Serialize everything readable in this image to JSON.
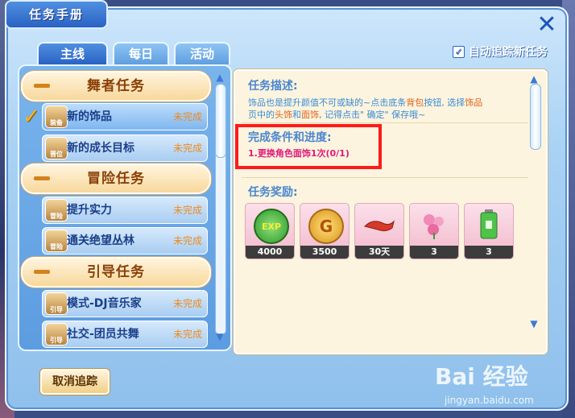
{
  "window": {
    "title": "任务手册",
    "close_symbol": "✕"
  },
  "tabs": [
    {
      "label": "主线",
      "active": true
    },
    {
      "label": "每日",
      "active": false
    },
    {
      "label": "活动",
      "active": false
    }
  ],
  "auto_track": {
    "label": "自动追踪新任务",
    "checked": true
  },
  "categories": [
    {
      "title": "舞者任务"
    },
    {
      "title": "冒险任务"
    },
    {
      "title": "引导任务"
    }
  ],
  "quests": [
    {
      "name": "新的饰品",
      "status": "未完成",
      "icon_label": "装备",
      "icon": "gear-chest-icon"
    },
    {
      "name": "新的成长目标",
      "status": "未完成",
      "icon_label": "晋位",
      "icon": "crown-icon"
    },
    {
      "name": "提升实力",
      "status": "未完成",
      "icon_label": "冒险",
      "icon": "chest-icon"
    },
    {
      "name": "通关绝望丛林",
      "status": "未完成",
      "icon_label": "冒险",
      "icon": "chest-icon"
    },
    {
      "name": "模式-DJ音乐家",
      "status": "未完成",
      "icon_label": "引导",
      "icon": "scroll-icon"
    },
    {
      "name": "社交-团员共舞",
      "status": "未完成",
      "icon_label": "引导",
      "icon": "scroll-icon"
    }
  ],
  "detail": {
    "desc_title": "任务描述:",
    "desc_text_1": "饰品也是提升颜值不可或缺的~点击底条",
    "desc_hl_1": "背包",
    "desc_text_2": "按钮, 选择",
    "desc_hl_2": "饰品",
    "desc_text_3": "页中的",
    "desc_hl_3": "头饰",
    "desc_text_4": "和",
    "desc_hl_4": "面饰",
    "desc_text_5": ", 记得点击\" 确定\" 保存哦~",
    "cond_title": "完成条件和进度:",
    "cond_text": "1.更换角色面饰1次(0/1)",
    "reward_title": "任务奖励:"
  },
  "rewards": [
    {
      "label": "EXP",
      "count": "4000",
      "icon": "exp-icon",
      "color": "#3fb03a"
    },
    {
      "label": "G",
      "count": "3500",
      "icon": "gold-coin-icon",
      "color": "#e9a81c"
    },
    {
      "label": "",
      "count": "30天",
      "icon": "red-accessory-icon",
      "color": "#d63a2a"
    },
    {
      "label": "",
      "count": "3",
      "icon": "flower-icon",
      "color": "#e87aa8"
    },
    {
      "label": "",
      "count": "3",
      "icon": "battery-can-icon",
      "color": "#4fc24a"
    }
  ],
  "buttons": {
    "cancel_track": "取消追踪"
  },
  "watermark": {
    "brand": "Bai 经验",
    "url": "jingyan.baidu.com"
  },
  "colors": {
    "accent": "#2a62c4",
    "status": "#f08a1a",
    "highlight": "#e0187a"
  }
}
